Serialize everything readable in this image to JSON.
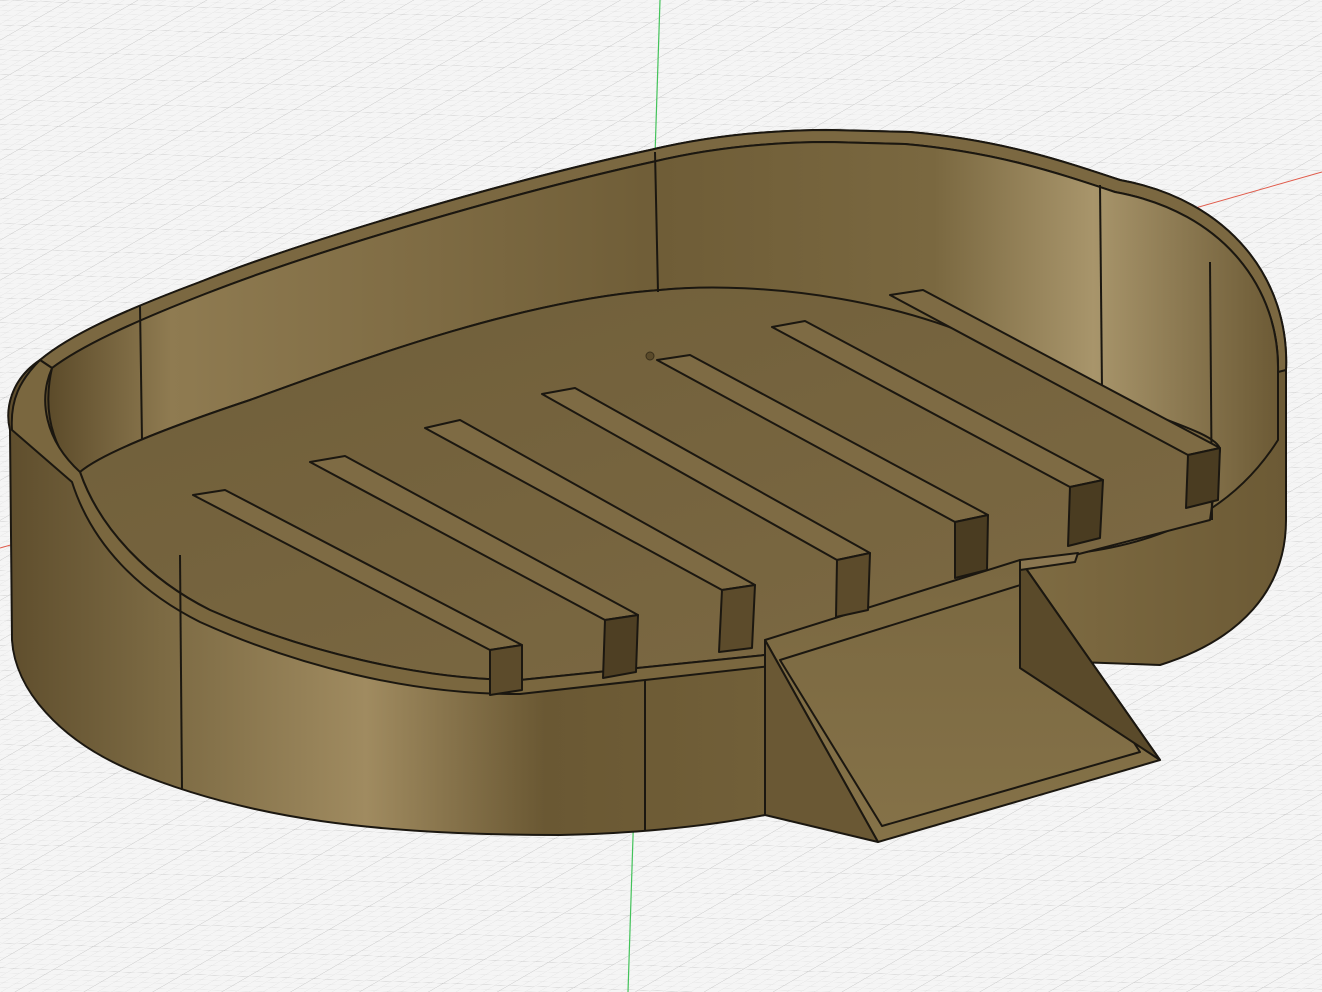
{
  "viewport": {
    "background": "#f5f5f5",
    "grid_minor_color": "#dcdcdc",
    "grid_major_color": "#bdbdbd",
    "x_axis_color": "#e05a4a",
    "y_axis_color": "#43c25a"
  },
  "model": {
    "name": "soap-dish",
    "material_color": "#7d6a45",
    "wall_color": "#6c5a36",
    "wall_highlight": "#a28e64",
    "floor_color": "#76653f",
    "edge_color": "#1b1710",
    "drain_rib_count": 7
  }
}
